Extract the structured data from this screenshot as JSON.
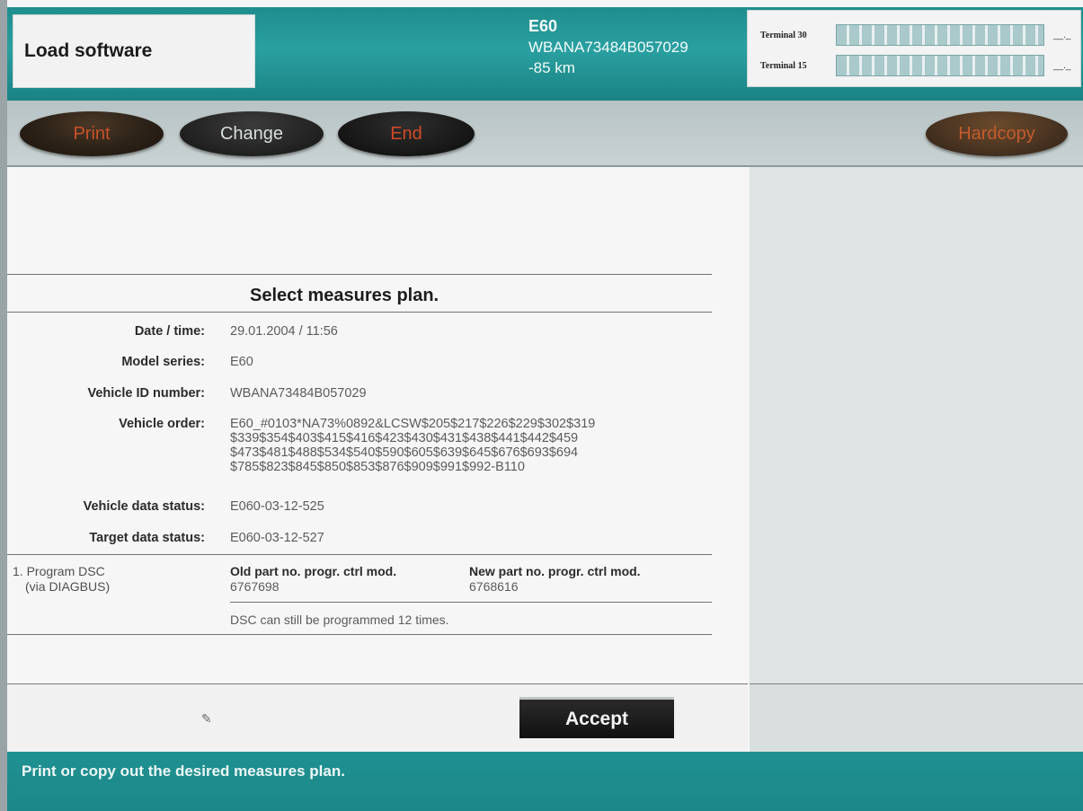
{
  "header": {
    "title": "Load software",
    "vehicle": {
      "model": "E60",
      "vin": "WBANA73484B057029",
      "mileage": "-85 km"
    },
    "terminals": [
      {
        "label": "Terminal 30",
        "value": "__._"
      },
      {
        "label": "Terminal 15",
        "value": "__._"
      }
    ]
  },
  "toolbar": {
    "print_label": "Print",
    "change_label": "Change",
    "end_label": "End",
    "hardcopy_label": "Hardcopy"
  },
  "plan": {
    "title": "Select measures plan.",
    "fields": {
      "datetime": {
        "label": "Date / time:",
        "value": "29.01.2004 / 11:56"
      },
      "model_series": {
        "label": "Model series:",
        "value": "E60"
      },
      "vin": {
        "label": "Vehicle ID number:",
        "value": "WBANA73484B057029"
      },
      "order": {
        "label": "Vehicle order:",
        "value": "E60_#0103*NA73%0892&LCSW$205$217$226$229$302$319\n$339$354$403$415$416$423$430$431$438$441$442$459\n$473$481$488$534$540$590$605$639$645$676$693$694\n$785$823$845$850$853$876$909$991$992-B110"
      },
      "vehicle_data_status": {
        "label": "Vehicle data status:",
        "value": "E060-03-12-525"
      },
      "target_data_status": {
        "label": "Target data status:",
        "value": "E060-03-12-527"
      }
    },
    "program": {
      "title": "1. Program DSC",
      "subtitle": "(via DIAGBUS)",
      "old_header": "Old part no. progr. ctrl mod.",
      "old_value": "6767698",
      "new_header": "New part no. progr. ctrl mod.",
      "new_value": "6768616",
      "note": "DSC can still be programmed 12 times."
    }
  },
  "footer": {
    "accept_label": "Accept",
    "status_text": "Print or copy out the desired measures plan."
  }
}
